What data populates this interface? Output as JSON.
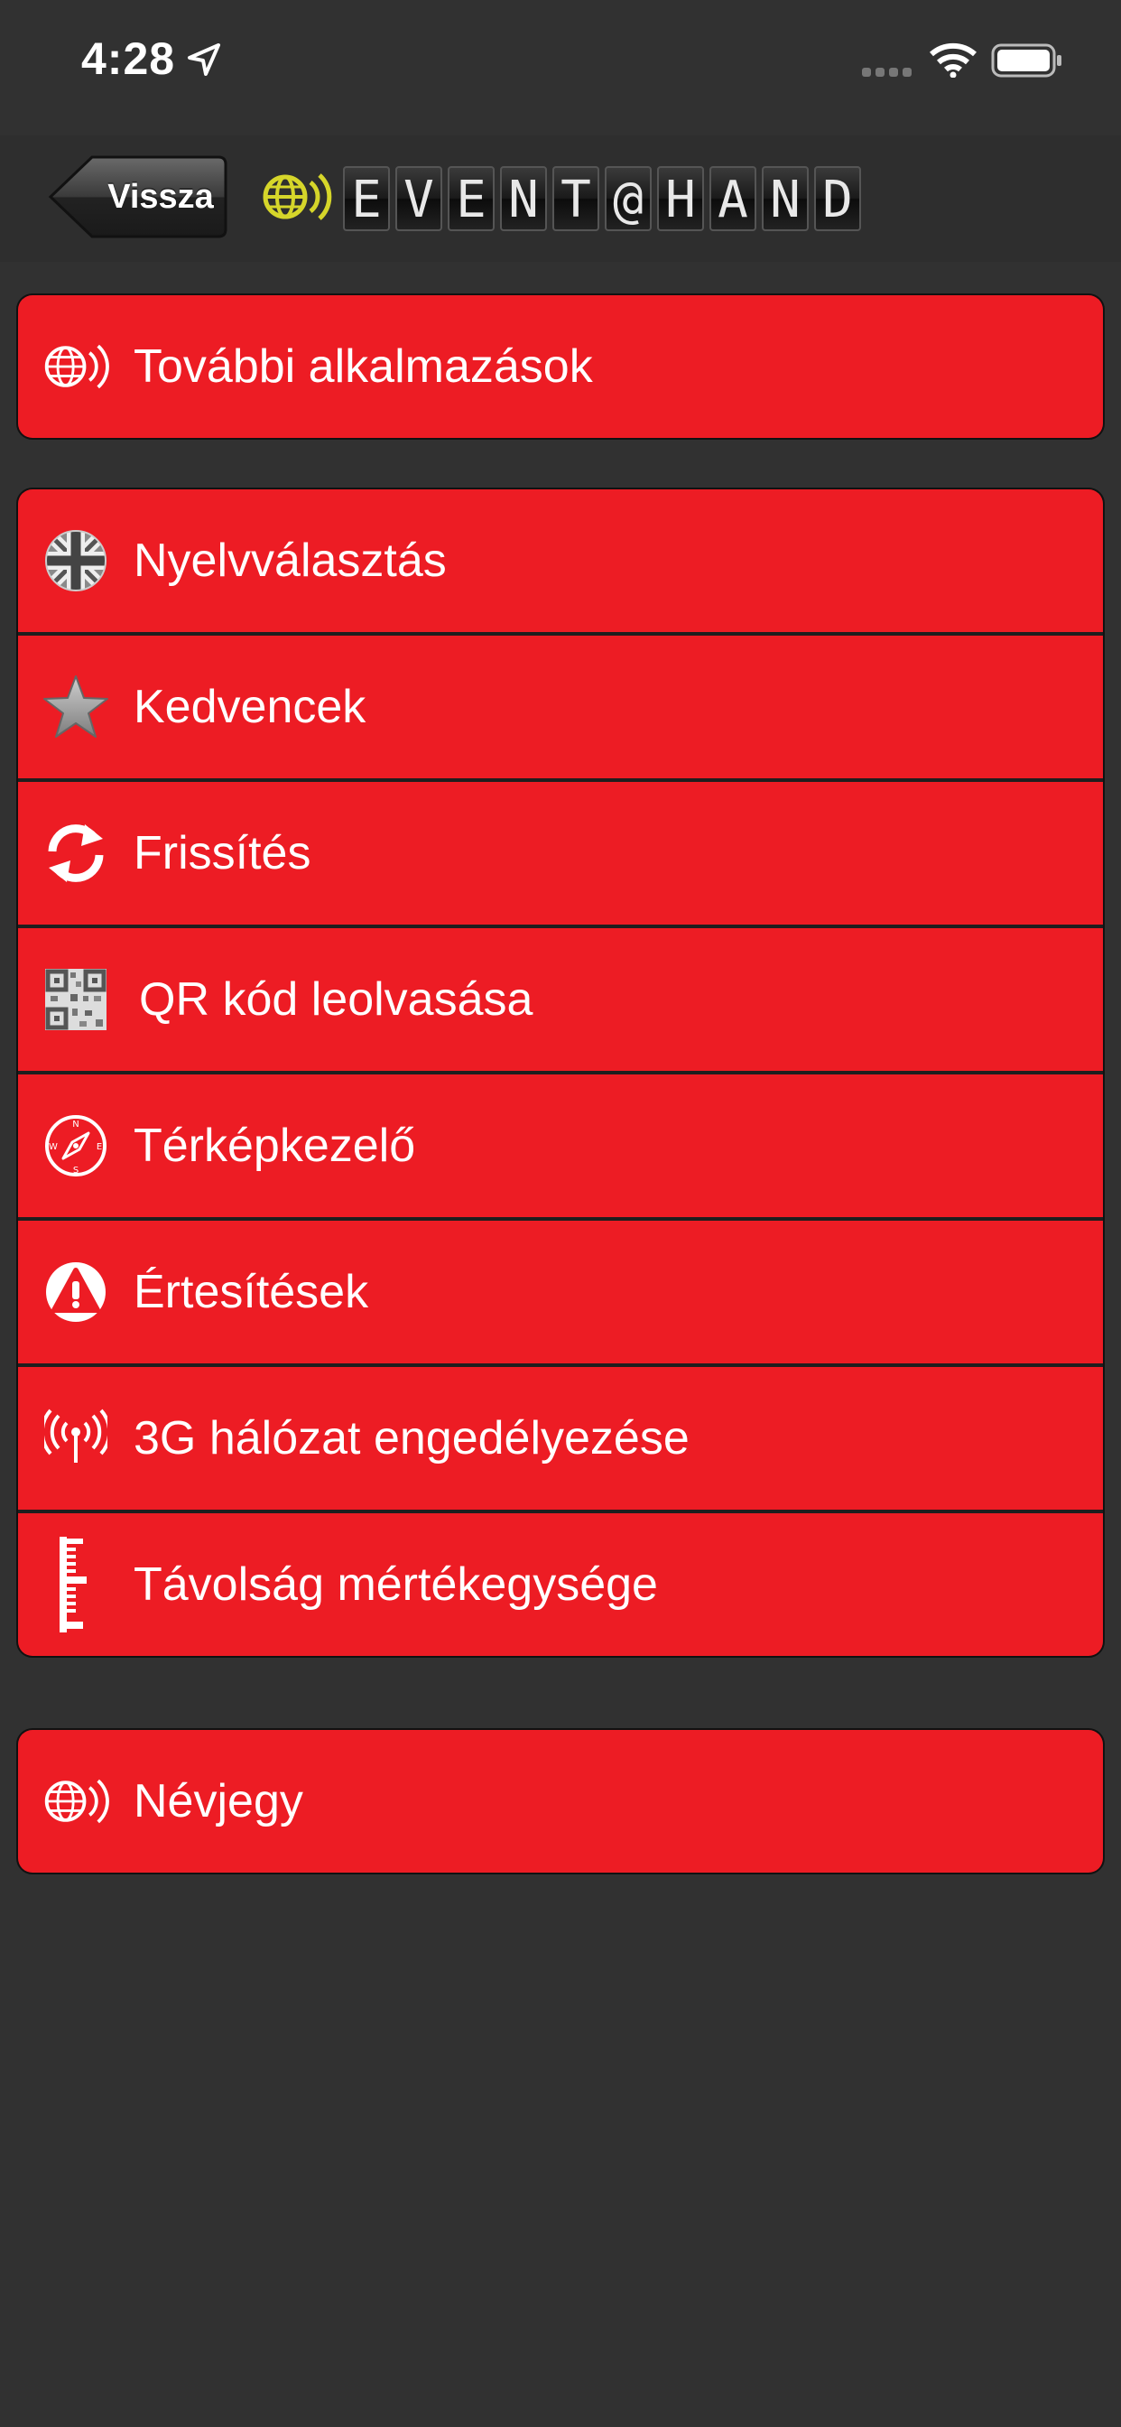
{
  "status_bar": {
    "time": "4:28"
  },
  "nav": {
    "back_label": "Vissza",
    "logo_letters": [
      "E",
      "V",
      "E",
      "N",
      "T",
      "@",
      "H",
      "A",
      "N",
      "D"
    ]
  },
  "colors": {
    "row_red": "#ed1c24",
    "background": "#313131"
  },
  "groups": [
    {
      "items": [
        {
          "label": "További alkalmazások",
          "icon": "globe-signal-icon"
        }
      ]
    },
    {
      "items": [
        {
          "label": "Nyelvválasztás",
          "icon": "uk-flag-icon"
        },
        {
          "label": "Kedvencek",
          "icon": "star-icon"
        },
        {
          "label": "Frissítés",
          "icon": "refresh-icon"
        },
        {
          "label": "QR kód leolvasása",
          "icon": "qr-code-icon"
        },
        {
          "label": "Térképkezelő",
          "icon": "compass-icon"
        },
        {
          "label": "Értesítések",
          "icon": "warning-icon"
        },
        {
          "label": "3G hálózat engedélyezése",
          "icon": "antenna-icon"
        },
        {
          "label": "Távolság mértékegysége",
          "icon": "ruler-icon"
        }
      ]
    },
    {
      "items": [
        {
          "label": "Névjegy",
          "icon": "globe-signal-icon"
        }
      ]
    }
  ]
}
